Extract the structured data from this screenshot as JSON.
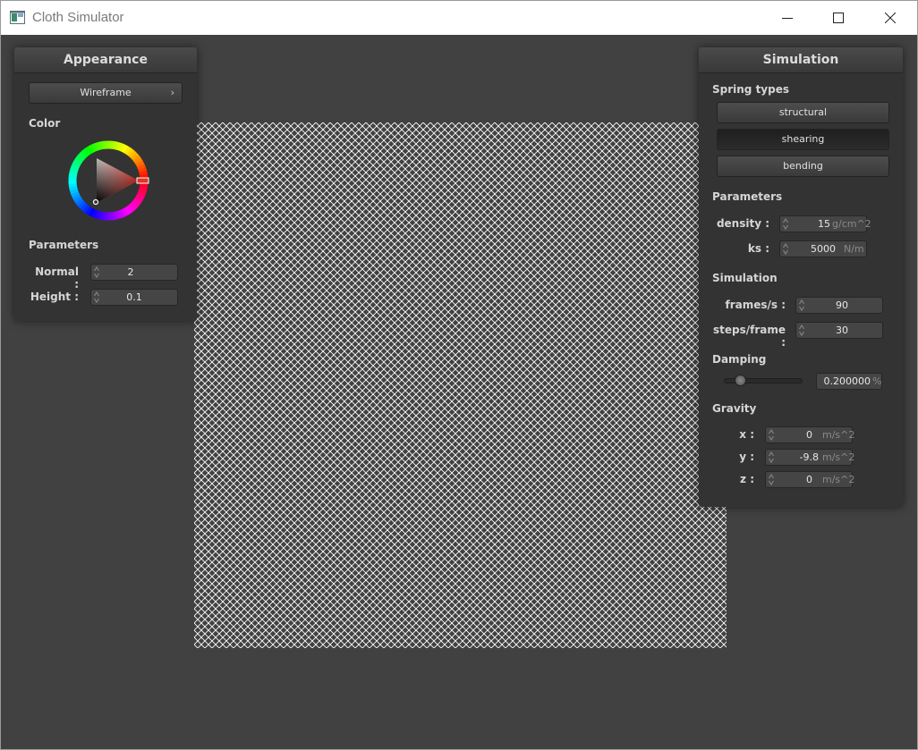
{
  "window": {
    "title": "Cloth Simulator"
  },
  "appearance": {
    "header": "Appearance",
    "shader_button": "Wireframe",
    "shader_arrow": "›",
    "color_label": "Color",
    "params_label": "Parameters",
    "normal_label": "Normal :",
    "normal_value": "2",
    "height_label": "Height :",
    "height_value": "0.1"
  },
  "simulation": {
    "header": "Simulation",
    "spring_types_label": "Spring types",
    "structural_button": "structural",
    "shearing_button": "shearing",
    "bending_button": "bending",
    "params_label": "Parameters",
    "density_label": "density :",
    "density_value": "15",
    "density_unit": "g/cm^2",
    "ks_label": "ks :",
    "ks_value": "5000",
    "ks_unit": "N/m",
    "sim_label": "Simulation",
    "fps_label": "frames/s :",
    "fps_value": "90",
    "steps_label": "steps/frame :",
    "steps_value": "30",
    "damping_label": "Damping",
    "damping_value": "0.200000",
    "damping_unit": "%",
    "damping_slider_fraction": 0.2,
    "gravity_label": "Gravity",
    "gx_label": "x :",
    "gx_value": "0",
    "gy_label": "y :",
    "gy_value": "-9.8",
    "gz_label": "z :",
    "gz_value": "0",
    "gravity_unit": "m/s^2"
  },
  "colors": {
    "cloth_lines": "#ffffff",
    "canvas_bg": "#414141",
    "selected_color": "#e0342a"
  }
}
